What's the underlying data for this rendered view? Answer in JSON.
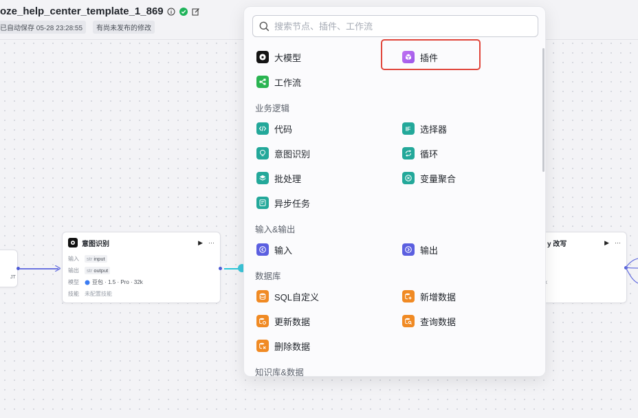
{
  "header": {
    "title": "oze_help_center_template_1_869",
    "autosave": "已自动保存 05-28 23:28:55",
    "unpublished": "有尚未发布的修改"
  },
  "nodes": {
    "intent": {
      "title": "意图识别",
      "rows": [
        {
          "key": "输入",
          "type": "str",
          "value": "input"
        },
        {
          "key": "输出",
          "type": "str",
          "value": "output"
        }
      ],
      "model_key": "模型",
      "model_value": "豆包 · 1.5 · Pro · 32k",
      "skill_key": "技能",
      "skill_value": "未配置技能"
    },
    "left_stub": {
      "text": "JT"
    },
    "right_node": {
      "title": "y 改写",
      "row_suffix": "k"
    }
  },
  "popover": {
    "search_placeholder": "搜索节点、插件、工作流",
    "top_items": [
      {
        "label": "大模型",
        "icon": "llm-icon"
      },
      {
        "label": "插件",
        "icon": "plugin-icon"
      },
      {
        "label": "工作流",
        "icon": "workflow-icon"
      }
    ],
    "sections": [
      {
        "title": "业务逻辑",
        "items": [
          {
            "label": "代码",
            "icon": "code-icon"
          },
          {
            "label": "选择器",
            "icon": "if-icon"
          },
          {
            "label": "意图识别",
            "icon": "bulb-icon"
          },
          {
            "label": "循环",
            "icon": "loop-icon"
          },
          {
            "label": "批处理",
            "icon": "layers-icon"
          },
          {
            "label": "变量聚合",
            "icon": "aggregate-icon"
          },
          {
            "label": "异步任务",
            "icon": "async-task-icon"
          }
        ]
      },
      {
        "title": "输入&输出",
        "items": [
          {
            "label": "输入",
            "icon": "input-icon"
          },
          {
            "label": "输出",
            "icon": "output-icon"
          }
        ]
      },
      {
        "title": "数据库",
        "items": [
          {
            "label": "SQL自定义",
            "icon": "database-icon"
          },
          {
            "label": "新增数据",
            "icon": "db-add-icon"
          },
          {
            "label": "更新数据",
            "icon": "db-update-icon"
          },
          {
            "label": "查询数据",
            "icon": "db-query-icon"
          },
          {
            "label": "删除数据",
            "icon": "db-delete-icon"
          }
        ]
      },
      {
        "title": "知识库&数据"
      }
    ]
  },
  "colors": {
    "accent": "#5b5fe0",
    "highlight_border": "#e0453a",
    "teal": "#23a89a",
    "orange": "#f08a24",
    "purple": "#a65cf0",
    "green": "#2ab451"
  }
}
